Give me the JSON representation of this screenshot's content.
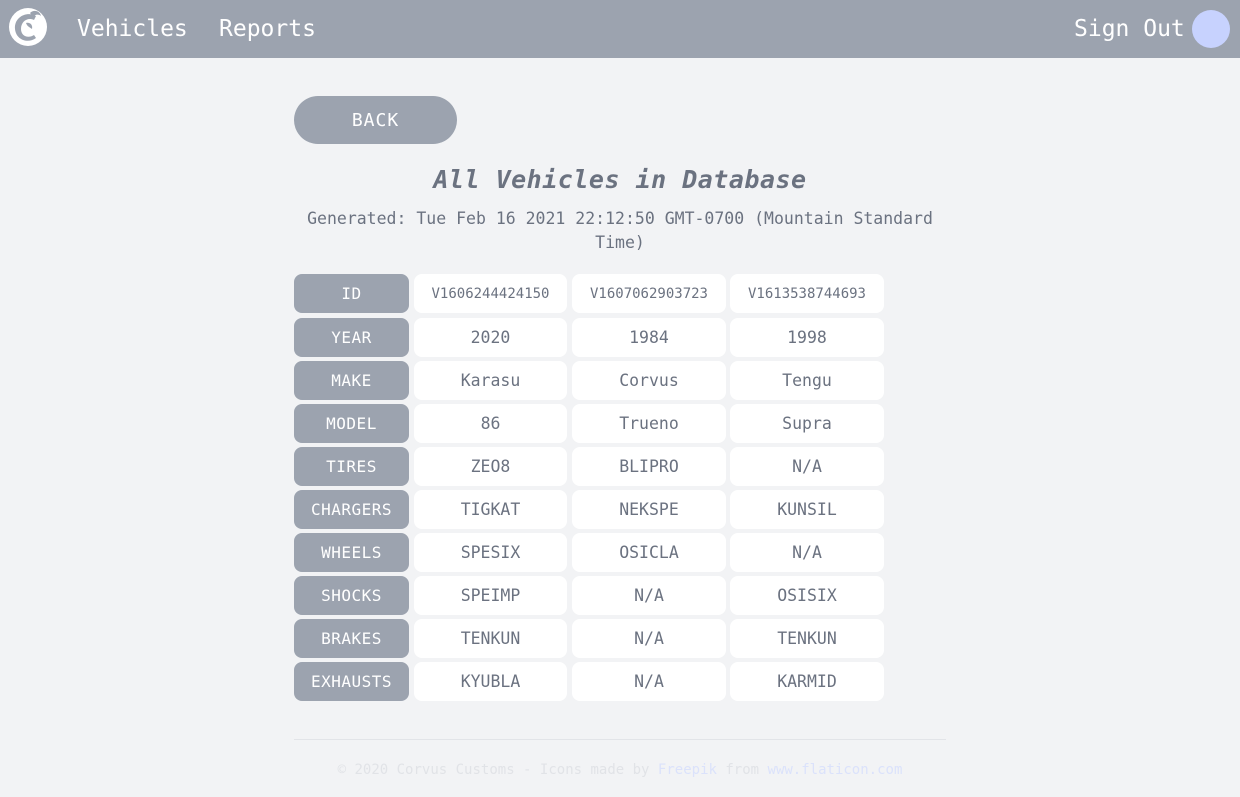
{
  "nav": {
    "vehicles": "Vehicles",
    "reports": "Reports",
    "sign_out": "Sign Out"
  },
  "back_label": "BACK",
  "title": "All Vehicles in Database",
  "generated": "Generated: Tue Feb 16 2021 22:12:50 GMT-0700 (Mountain Standard Time)",
  "table": {
    "rows": [
      {
        "label": "ID",
        "values": [
          "V1606244424150",
          "V1607062903723",
          "V1613538744693"
        ]
      },
      {
        "label": "YEAR",
        "values": [
          "2020",
          "1984",
          "1998"
        ]
      },
      {
        "label": "MAKE",
        "values": [
          "Karasu",
          "Corvus",
          "Tengu"
        ]
      },
      {
        "label": "MODEL",
        "values": [
          "86",
          "Trueno",
          "Supra"
        ]
      },
      {
        "label": "TIRES",
        "values": [
          "ZEO8",
          "BLIPRO",
          "N/A"
        ]
      },
      {
        "label": "CHARGERS",
        "values": [
          "TIGKAT",
          "NEKSPE",
          "KUNSIL"
        ]
      },
      {
        "label": "WHEELS",
        "values": [
          "SPESIX",
          "OSICLA",
          "N/A"
        ]
      },
      {
        "label": "SHOCKS",
        "values": [
          "SPEIMP",
          "N/A",
          "OSISIX"
        ]
      },
      {
        "label": "BRAKES",
        "values": [
          "TENKUN",
          "N/A",
          "TENKUN"
        ]
      },
      {
        "label": "EXHAUSTS",
        "values": [
          "KYUBLA",
          "N/A",
          "KARMID"
        ]
      }
    ]
  },
  "footer": {
    "prefix": "© 2020 Corvus Customs - Icons made by ",
    "freepik": "Freepik",
    "from": " from ",
    "flaticon": "www.flaticon.com"
  },
  "colors": {
    "navbar": "#9ca3af",
    "background": "#f2f3f5",
    "avatar": "#c7d2fe",
    "text": "#6b7280"
  },
  "icons": {
    "logo": "corvus-logo-icon"
  }
}
